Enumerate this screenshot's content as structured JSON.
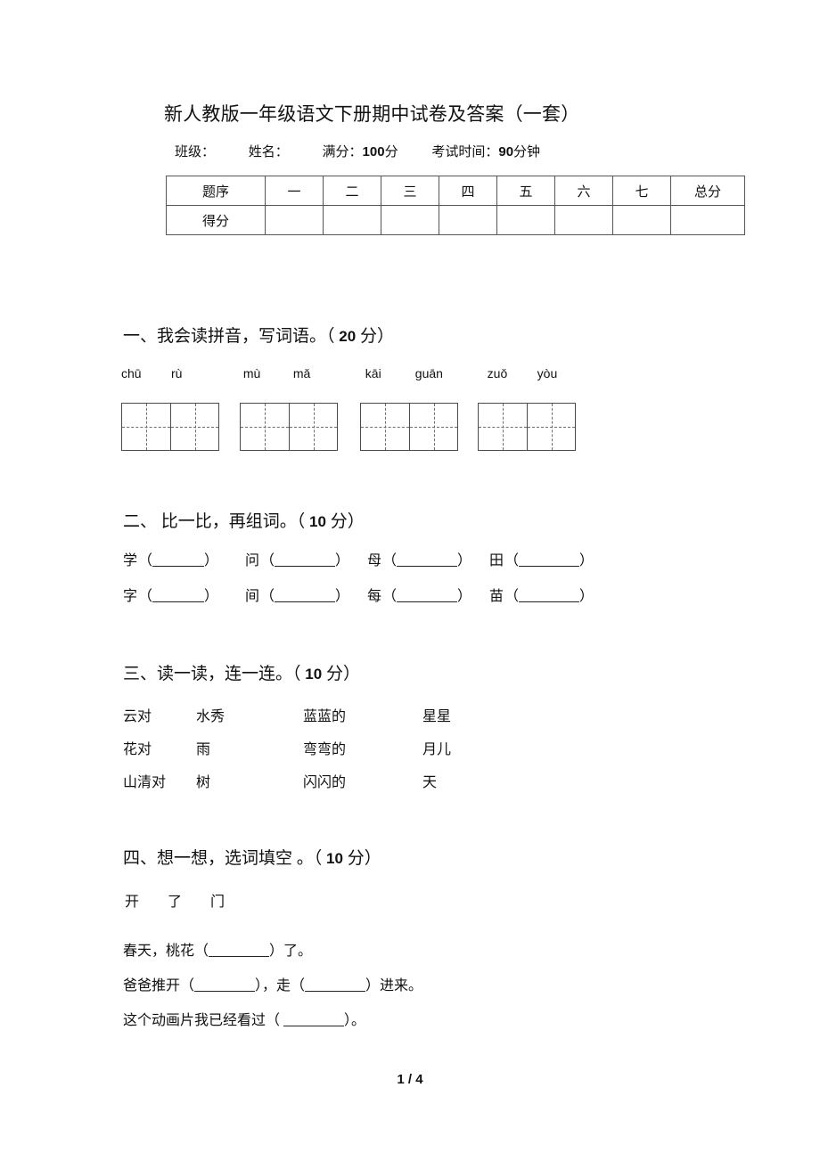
{
  "document": {
    "title": "新人教版一年级语文下册期中试卷及答案（一套）",
    "footer_page": "1 / 4"
  },
  "header": {
    "class_label": "班级：",
    "name_label": "姓名：",
    "full_score_label": "满分：",
    "full_score_value": "100",
    "full_score_unit": "分",
    "time_label": "考试时间：",
    "time_value": "90",
    "time_unit": "分钟"
  },
  "score_table": {
    "row_labels": [
      "题序",
      "得分"
    ],
    "columns": [
      "一",
      "二",
      "三",
      "四",
      "五",
      "六",
      "七"
    ],
    "total_label": "总分",
    "scores": [
      "",
      "",
      "",
      "",
      "",
      "",
      "",
      ""
    ]
  },
  "sections": [
    {
      "heading": "一、我会读拼音，写词语。（",
      "points": "20",
      "heading_tail": "分）",
      "pinyin_groups": [
        {
          "syllables": [
            "chū",
            "rù"
          ]
        },
        {
          "syllables": [
            "mù",
            "mǎ"
          ]
        },
        {
          "syllables": [
            "kāi",
            "guān"
          ]
        },
        {
          "syllables": [
            "zuǒ",
            "yòu"
          ]
        }
      ],
      "grid_boxes": 4,
      "cells_per_box": 2
    },
    {
      "heading": "二、 比一比，再组词。（",
      "points": "10",
      "heading_tail": "分）",
      "rows": [
        {
          "items": [
            "学",
            "问",
            "母",
            "田"
          ]
        },
        {
          "items": [
            "字",
            "间",
            "每",
            "苗"
          ]
        }
      ]
    },
    {
      "heading": "三、读一读，连一连。（",
      "points": "10",
      "heading_tail": "分）",
      "rows": [
        {
          "cols": [
            "云对",
            "水秀",
            "蓝蓝的",
            "星星"
          ]
        },
        {
          "cols": [
            "花对",
            "雨",
            "弯弯的",
            "月儿"
          ]
        },
        {
          "cols": [
            "山清对",
            "树",
            "闪闪的",
            "天"
          ]
        }
      ]
    },
    {
      "heading": "四、想一想，选词填空  。（",
      "points": "10",
      "heading_tail": "分）",
      "word_bank": [
        "开",
        "了",
        "门"
      ],
      "sentences": [
        {
          "before": "春天，桃花（",
          "after": "）了。",
          "mid": "",
          "second_after": ""
        },
        {
          "before": "爸爸推开（",
          "after": "），走（",
          "mid": "",
          "second_after": "）进来。"
        },
        {
          "before": "这个动画片我已经看过（ ",
          "after": "）。",
          "mid": "",
          "second_after": ""
        }
      ]
    }
  ],
  "colors": {
    "text": "#111111",
    "table_border": "#555555",
    "grid_border": "#4a4a4a",
    "grid_dash": "#6d6d6d"
  }
}
